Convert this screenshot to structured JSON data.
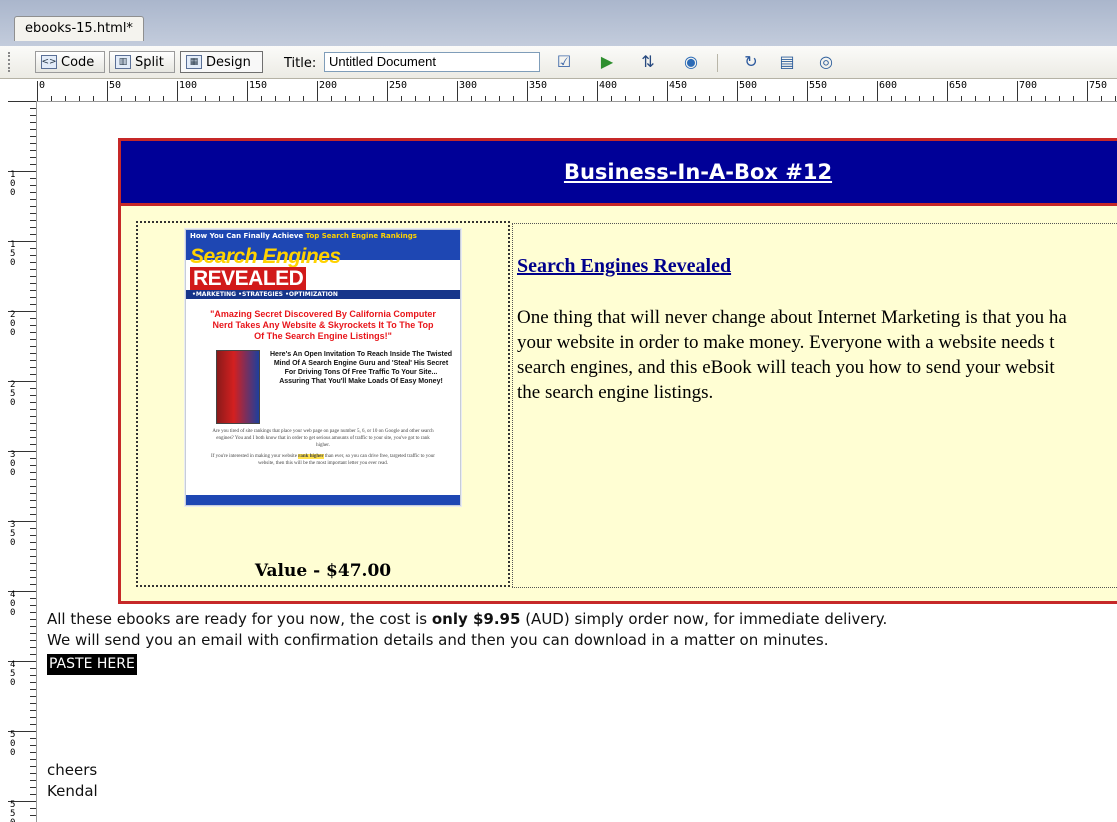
{
  "tab": {
    "label": "ebooks-15.html*"
  },
  "toolbar": {
    "code_label": "Code",
    "split_label": "Split",
    "design_label": "Design",
    "title_label": "Title:",
    "title_value": "Untitled Document",
    "icons": [
      "validate-icon",
      "preview-browser-icon",
      "file-transfer-icon",
      "globe-icon",
      "refresh-icon",
      "view-options-icon",
      "visual-aids-icon"
    ]
  },
  "ruler": {
    "horizontal_labels": [
      "0",
      "50",
      "100",
      "150",
      "200",
      "250",
      "300",
      "350",
      "400",
      "450",
      "500",
      "550",
      "600",
      "650",
      "700",
      "750"
    ],
    "vertical_labels": [
      "100",
      "150",
      "200",
      "250",
      "300",
      "350",
      "400",
      "450",
      "500",
      "550"
    ]
  },
  "page": {
    "box_title": "Business-In-A-Box #12",
    "cover": {
      "tagline_prefix": "How You Can Finally Achieve",
      "tagline_highlight": "Top Search Engine Rankings",
      "brand_part1": "Search Engines",
      "brand_part2": "REVEALED",
      "bar_text": "•MARKETING •STRATEGIES •OPTIMIZATION",
      "headline": "\"Amazing Secret Discovered By California Computer Nerd Takes Any Website & Skyrockets It To The Top Of The Search Engine Listings!\"",
      "invite": "Here's An Open Invitation To Reach Inside The Twisted Mind Of A Search Engine Guru and 'Steal' His Secret For Driving Tons Of Free Traffic To Your Site... Assuring That You'll Make Loads Of Easy Money!",
      "small_text": "Are you tired of site rankings that place your web page on page number 5, 6, or 10 on Google and other search engines? You and I both know that in order to get serious amounts of traffic to your site, you've got to rank higher.",
      "small_text2_prefix": "If you're interested in making your website",
      "small_text2_highlight": "rank higher",
      "small_text2_suffix": "than ever, so you can drive free, targeted traffic to your website, then this will be the most important letter you ever read."
    },
    "value_text": "Value - $47.00",
    "product_title": "Search Engines Revealed",
    "product_desc_lines": [
      "One thing that will never change about Internet Marketing is that you ha",
      "your website in order to make money. Everyone with a website needs t",
      "search engines, and this eBook will teach you how to send your websit",
      "the search engine listings."
    ],
    "offer_line1_before": "All these ebooks are ready for you now, the cost is ",
    "offer_line1_bold": "only $9.95",
    "offer_line1_after": " (AUD) simply order now, for immediate delivery.",
    "offer_line2": "We will send you an email with confirmation details and then you can download in a matter on minutes.",
    "paste_text": "PASTE HERE",
    "signoff_line1": "cheers",
    "signoff_line2": "Kendal"
  }
}
